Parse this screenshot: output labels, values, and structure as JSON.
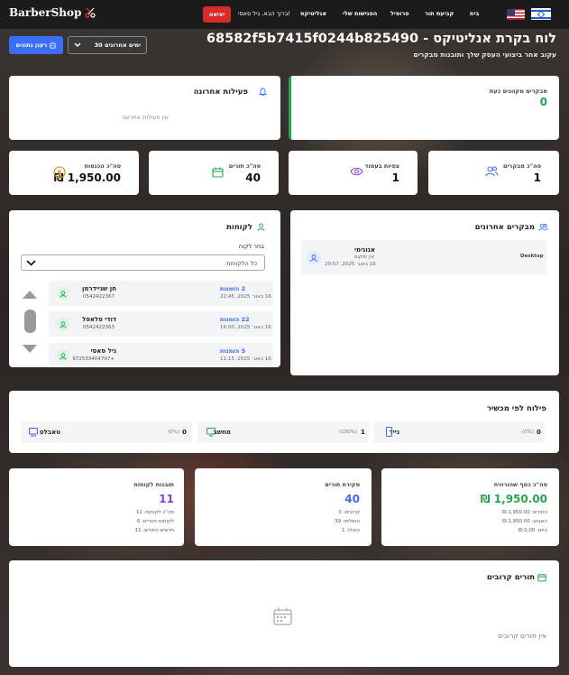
{
  "nav": {
    "logo": "BarberShop",
    "logout": "יציאה",
    "greeting": "ברוך הבא, גיל סאסי!",
    "links": [
      "אנליטיקס",
      "הפגישות שלי",
      "פרופיל",
      "קביעת תור",
      "בית"
    ]
  },
  "header": {
    "title": "לוח בקרת אנליטיקס - 68582f5b7415f0244b825490",
    "subtitle": "עקוב אחר ביצועי העסק שלך ותובנות מבקרים",
    "refresh_label": "רענן נתונים",
    "range_label": "30 ימים אחרונים"
  },
  "live_visitors": {
    "label": "מבקרים מקוונים כעת",
    "value": "0"
  },
  "recent_activity": {
    "title": "פעילות אחרונה",
    "empty": "אין פעילות אחרונה"
  },
  "stats": [
    {
      "label": "סה\"כ מבקרים",
      "value": "1",
      "color": "#3b6ef5"
    },
    {
      "label": "צפיות בעמוד",
      "value": "1",
      "color": "#8b3fd6"
    },
    {
      "label": "סה\"כ תורים",
      "value": "40",
      "color": "#2aa34a"
    },
    {
      "label": "סה\"כ הכנסות",
      "value": "₪ 1,950.00",
      "color": "#c98a12"
    }
  ],
  "recent_visitors": {
    "title": "מבקרים אחרונים",
    "items": [
      {
        "name": "אנונימי",
        "location": "אין מיקום",
        "time": "16 באוג׳ 2025, 20:57",
        "device": "Desktop"
      }
    ]
  },
  "clients": {
    "title": "לקוחות",
    "select_label": "בחר לקוח",
    "select_value": "כל הלקוחות",
    "rows": [
      {
        "name": "חן שניידרמן",
        "phone": "0542422367",
        "visits": "2 הזמנות",
        "last": "16 באוג׳ 2025, 22:45"
      },
      {
        "name": "דודי פלאפל",
        "phone": "0542422363",
        "visits": "22 הזמנות",
        "last": "16 באוג׳ 2025, 16:00"
      },
      {
        "name": "גיל סאסי",
        "phone": "972533404797+",
        "visits": "5 הזמנות",
        "last": "16 באוג׳ 2025, 11:15"
      }
    ]
  },
  "devices": {
    "title": "פילוח לפי מכשיר",
    "items": [
      {
        "name": "נייד",
        "count": "0",
        "pct": "(0%)"
      },
      {
        "name": "מחשב",
        "count": "1",
        "pct": "(100%)"
      },
      {
        "name": "טאבלט",
        "count": "0",
        "pct": "(0%)"
      }
    ]
  },
  "money": {
    "title": "סה\"כ כסף שהורוויח",
    "value": "₪ 1,950.00",
    "lines": [
      "החודש: 1,950.00 ₪",
      "השבוע: 1,950.00 ₪",
      "היום: 0.00 ₪"
    ]
  },
  "appointments_overview": {
    "title": "סקירת תורים",
    "value": "40",
    "lines": [
      "קרובים: 0",
      "הושלמו: 39",
      "בוטלו: 1"
    ]
  },
  "client_insights": {
    "title": "תובנות לקוחות",
    "value": "11",
    "lines": [
      "סה\"כ לקוחות: 11",
      "לקוחות חוזרים: 6",
      "חדשים החודש: 11"
    ]
  },
  "upcoming": {
    "title": "תורים קרובים",
    "empty": "אין תורים קרובים"
  }
}
